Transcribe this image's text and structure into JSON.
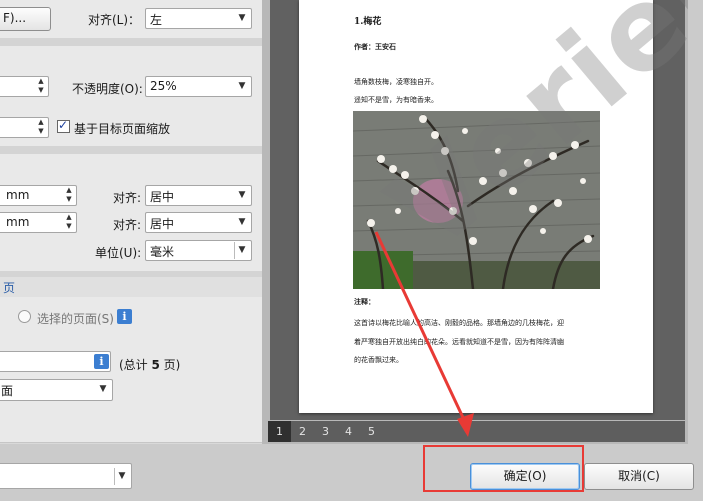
{
  "left_panel": {
    "fit_button_label": "F)...",
    "align1_label": "对齐(L)：",
    "align1_value": "左",
    "opacity_label": "不透明度(O):",
    "opacity_value": "25%",
    "scale_checkbox_label": "基于目标页面缩放",
    "unit_mm_1": "mm",
    "unit_mm_2": "mm",
    "align2_label": "对齐:",
    "align2_value": "居中",
    "align3_label": "对齐:",
    "align3_value": "居中",
    "unit_label": "单位(U):",
    "unit_value": "毫米",
    "page_section_title": "页",
    "selected_pages_label": "选择的页面(S)",
    "total_pages_prefix": "(总计 ",
    "total_pages_count": "5",
    "total_pages_suffix": " 页)",
    "page_type_value": "面"
  },
  "preview": {
    "poem_title": "1.梅花",
    "author": "作者：王安石",
    "line1": "墙角数枝梅，凌寒独自开。",
    "line2": "遥知不是雪，为有暗香来。",
    "note_title": "注释：",
    "note_line1": "这首诗以梅花比喻人的高洁、刚毅的品格。那墙角边的几枝梅花，迎",
    "note_line2": "着严寒独自开放出纯白的花朵。远看就知道不是雪，因为有阵阵清幽",
    "note_line3": "的花香飘过来。",
    "watermark_text": "Verieu",
    "pages": [
      "1",
      "2",
      "3",
      "4",
      "5"
    ],
    "active_page": "1"
  },
  "buttons": {
    "ok_label": "确定(O)",
    "cancel_label": "取消(C)"
  },
  "colors": {
    "highlight": "#e83a35",
    "arrow": "#e83a35",
    "info_icon": "#3b7ed1"
  }
}
